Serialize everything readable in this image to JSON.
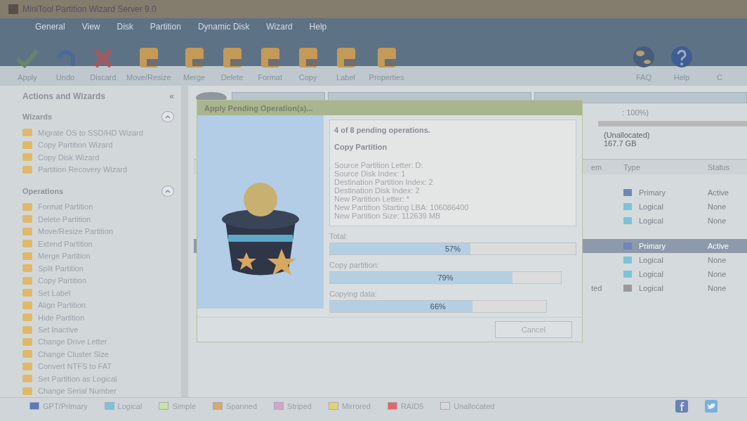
{
  "window": {
    "title": "MiniTool Partition Wizard Server 9.0"
  },
  "menu": [
    "General",
    "View",
    "Disk",
    "Partition",
    "Dynamic Disk",
    "Wizard",
    "Help"
  ],
  "toolbar": [
    {
      "label": "Apply",
      "kind": "check"
    },
    {
      "label": "Undo",
      "kind": "undo"
    },
    {
      "label": "Discard",
      "kind": "cross"
    },
    {
      "label": "Move/Resize",
      "kind": "doc"
    },
    {
      "label": "Merge",
      "kind": "doc"
    },
    {
      "label": "Delete",
      "kind": "doc"
    },
    {
      "label": "Format",
      "kind": "doc"
    },
    {
      "label": "Copy",
      "kind": "doc"
    },
    {
      "label": "Label",
      "kind": "doc"
    },
    {
      "label": "Properties",
      "kind": "doc"
    }
  ],
  "toolbar_right": [
    {
      "label": "FAQ",
      "kind": "globe"
    },
    {
      "label": "Help",
      "kind": "help"
    },
    {
      "label": "C",
      "kind": "none"
    }
  ],
  "sidebar": {
    "title": "Actions and Wizards",
    "collapse_glyph": "«",
    "sections": [
      {
        "title": "Wizards",
        "expanded": true,
        "items": [
          "Migrate OS to SSD/HD Wizard",
          "Copy Partition Wizard",
          "Copy Disk Wizard",
          "Partition Recovery Wizard"
        ]
      },
      {
        "title": "Operations",
        "expanded": true,
        "items": [
          "Format Partition",
          "Delete Partition",
          "Move/Resize Partition",
          "Extend Partition",
          "Merge Partition",
          "Split Partition",
          "Copy Partition",
          "Set Label",
          "Align Partition",
          "Hide Partition",
          "Set Inactive",
          "Change Drive Letter",
          "Change Cluster Size",
          "Convert NTFS to FAT",
          "Set Partition as Logical",
          "Change Serial Number"
        ]
      }
    ]
  },
  "disk_map": {
    "usage_note": ": 100%)",
    "unallocated_label": "(Unallocated)",
    "unallocated_size": "167.7 GB"
  },
  "table": {
    "columns": [
      "em",
      "Type",
      "Status"
    ],
    "rows": [
      {
        "column_1": "",
        "type": "Primary",
        "status": "Active",
        "color": "#6f86b8",
        "selected": false
      },
      {
        "column_1": "",
        "type": "Logical",
        "status": "None",
        "color": "#7cc3d6",
        "selected": false
      },
      {
        "column_1": "",
        "type": "Logical",
        "status": "None",
        "color": "#7cc3d6",
        "selected": false
      },
      {
        "column_1": "",
        "type": "Primary",
        "status": "Active",
        "color": "#6f86b8",
        "selected": true
      },
      {
        "column_1": "",
        "type": "Logical",
        "status": "None",
        "color": "#7cc3d6",
        "selected": false
      },
      {
        "column_1": "",
        "type": "Logical",
        "status": "None",
        "color": "#7cc3d6",
        "selected": false
      },
      {
        "column_1": "ted",
        "type": "Logical",
        "status": "None",
        "color": "#9a9a9a",
        "selected": false
      }
    ]
  },
  "dialog": {
    "title": "Apply Pending Operation(s)...",
    "count": "4 of 8 pending operations.",
    "operation": "Copy Partition",
    "details": [
      "Source Partition Letter: D:",
      "Source Disk Index: 1",
      "Destination Partition Index: 2",
      "Destination Disk Index: 2",
      "New Partition Letter: *",
      "New Partition Starting LBA: 106086400",
      "New Partition Size: 112639 MB"
    ],
    "progress": [
      {
        "label": "Total:",
        "reading": "57%",
        "level": 0.57
      },
      {
        "label": "Copy partition:",
        "reading": "79%",
        "level": 0.79
      },
      {
        "label": "Copying data:",
        "reading": "66%",
        "level": 0.66
      }
    ],
    "cancel": "Cancel"
  },
  "legend": [
    {
      "label": "GPT/Primary",
      "color": "#5d79b4"
    },
    {
      "label": "Logical",
      "color": "#7cc3d6"
    },
    {
      "label": "Simple",
      "color": "#c8e2a4"
    },
    {
      "label": "Spanned",
      "color": "#d8a86a"
    },
    {
      "label": "Striped",
      "color": "#d4a4c8"
    },
    {
      "label": "Mirrored",
      "color": "#e2d472"
    },
    {
      "label": "RAID5",
      "color": "#e06868"
    },
    {
      "label": "Unallocated",
      "color": "#d8d8d8"
    }
  ]
}
